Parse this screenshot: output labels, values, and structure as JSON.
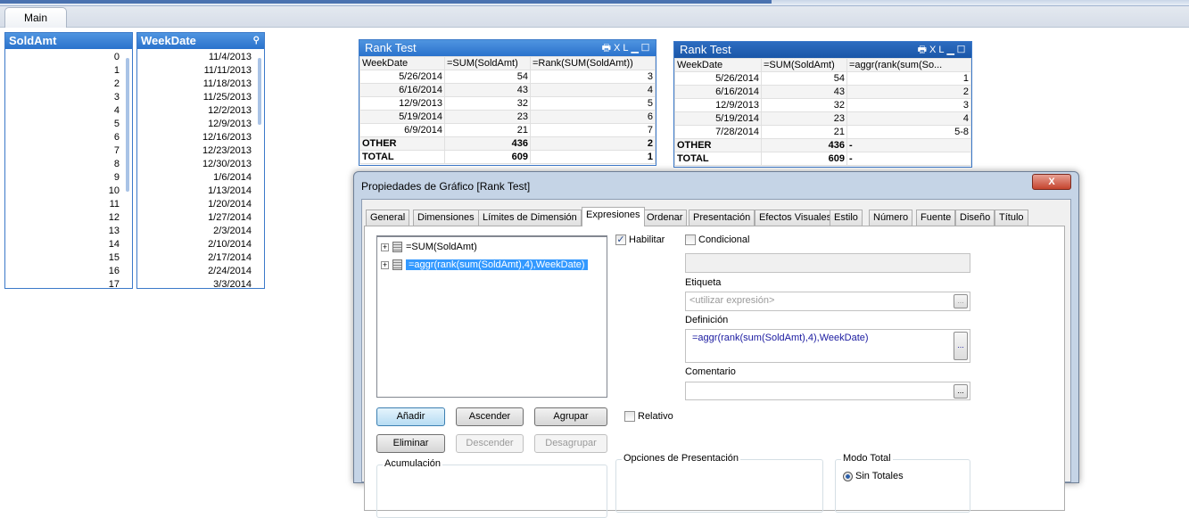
{
  "tabs": [
    {
      "label": "Main"
    }
  ],
  "listbox_soldamt": {
    "title": "SoldAmt",
    "items": [
      "0",
      "1",
      "2",
      "3",
      "4",
      "5",
      "6",
      "7",
      "8",
      "9",
      "10",
      "11",
      "12",
      "13",
      "14",
      "15",
      "16",
      "17"
    ]
  },
  "listbox_weekdate": {
    "title": "WeekDate",
    "items": [
      "11/4/2013",
      "11/11/2013",
      "11/18/2013",
      "11/25/2013",
      "12/2/2013",
      "12/9/2013",
      "12/16/2013",
      "12/23/2013",
      "12/30/2013",
      "1/6/2014",
      "1/13/2014",
      "1/20/2014",
      "1/27/2014",
      "2/3/2014",
      "2/10/2014",
      "2/17/2014",
      "2/24/2014",
      "3/3/2014"
    ]
  },
  "table1": {
    "title": "Rank Test",
    "icons": "XL",
    "headers": [
      "WeekDate",
      "=SUM(SoldAmt)",
      "=Rank(SUM(SoldAmt))"
    ],
    "rows": [
      [
        "5/26/2014",
        "54",
        "3"
      ],
      [
        "6/16/2014",
        "43",
        "4"
      ],
      [
        "12/9/2013",
        "32",
        "5"
      ],
      [
        "5/19/2014",
        "23",
        "6"
      ],
      [
        "6/9/2014",
        "21",
        "7"
      ],
      [
        "OTHER",
        "436",
        "2"
      ],
      [
        "TOTAL",
        "609",
        "1"
      ]
    ]
  },
  "table2": {
    "title": "Rank Test",
    "icons": "XL",
    "headers": [
      "WeekDate",
      "=SUM(SoldAmt)",
      "=aggr(rank(sum(So..."
    ],
    "rows": [
      [
        "5/26/2014",
        "54",
        "1"
      ],
      [
        "6/16/2014",
        "43",
        "2"
      ],
      [
        "12/9/2013",
        "32",
        "3"
      ],
      [
        "5/19/2014",
        "23",
        "4"
      ],
      [
        "7/28/2014",
        "21",
        "5-8"
      ],
      [
        "OTHER",
        "436",
        "-"
      ],
      [
        "TOTAL",
        "609",
        "-"
      ]
    ]
  },
  "dialog": {
    "title": "Propiedades de Gráfico [Rank Test]",
    "close": "X",
    "tabs": [
      "General",
      "Dimensiones",
      "Límites de Dimensión",
      "Expresiones",
      "Ordenar",
      "Presentación",
      "Efectos Visuales",
      "Estilo",
      "Número",
      "Fuente",
      "Diseño",
      "Título"
    ],
    "expressions": [
      "=SUM(SoldAmt)",
      "=aggr(rank(sum(SoldAmt),4),WeekDate)"
    ],
    "habilitar": "Habilitar",
    "condicional": "Condicional",
    "etiqueta_label": "Etiqueta",
    "etiqueta_placeholder": "<utilizar expresión>",
    "definicion_label": "Definición",
    "definicion_value": "=aggr(rank(sum(SoldAmt),4),WeekDate)",
    "comentario_label": "Comentario",
    "dots": "...",
    "buttons": {
      "add": "Añadir",
      "up": "Ascender",
      "group": "Agrupar",
      "delete": "Eliminar",
      "down": "Descender",
      "ungroup": "Desagrupar"
    },
    "relativo": "Relativo",
    "acumulacion": "Acumulación",
    "opciones": "Opciones de Presentación",
    "modo_total": "Modo Total",
    "sin_totales": "Sin Totales"
  }
}
